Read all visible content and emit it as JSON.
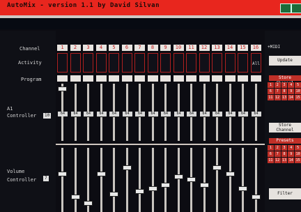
{
  "window": {
    "title": "AutoMix - version 1.1 by David Silvan"
  },
  "labels": {
    "channel": "Channel",
    "activity": "Activity",
    "program": "Program",
    "cc1": "Controller",
    "cc1_prefix": "A1",
    "cc1_num": "10",
    "cc2": "Volume Controller",
    "cc2_num": "7",
    "all": "All",
    "midi": "+MIDI"
  },
  "channels": [
    "1",
    "2",
    "3",
    "4",
    "5",
    "6",
    "7",
    "8",
    "9",
    "10",
    "11",
    "12",
    "13",
    "14",
    "15",
    "16"
  ],
  "cc1_values": [
    "64",
    "64",
    "64",
    "64",
    "64",
    "64",
    "64",
    "64",
    "64",
    "64",
    "64",
    "64",
    "64",
    "64",
    "64",
    "64"
  ],
  "cc1_levels": [
    0.95,
    0.45,
    0.45,
    0.45,
    0.45,
    0.45,
    0.45,
    0.45,
    0.45,
    0.45,
    0.45,
    0.45,
    0.45,
    0.45,
    0.45,
    0.45
  ],
  "cc2_levels": [
    0.6,
    0.2,
    0.1,
    0.6,
    0.25,
    0.7,
    0.3,
    0.35,
    0.4,
    0.55,
    0.5,
    0.4,
    0.7,
    0.6,
    0.35,
    0.2
  ],
  "right": {
    "update_label": "Update",
    "store_label": "Store Channel",
    "store2_label": "Store Channel",
    "presets_label": "Presets",
    "keys": [
      "1",
      "2",
      "3",
      "4",
      "5",
      "6",
      "7",
      "8",
      "9",
      "10",
      "11",
      "12",
      "13",
      "14",
      "15"
    ],
    "keys2": [
      "1",
      "2",
      "3",
      "4",
      "5",
      "6",
      "7",
      "8",
      "9",
      "10",
      "11",
      "12",
      "13",
      "14",
      "15"
    ],
    "filter_label": "Filter"
  },
  "colors": {
    "accent": "#e8261e",
    "bg": "#0c0c12",
    "track": "#c8c4bf"
  }
}
